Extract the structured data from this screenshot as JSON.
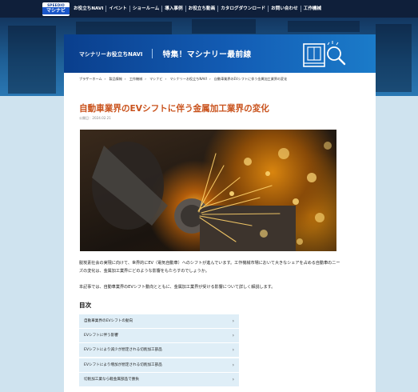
{
  "logo": {
    "line1": "SPEEDIO",
    "line2": "マシナビ"
  },
  "nav": {
    "items": [
      "お役立ちNAVI",
      "イベント",
      "ショールーム",
      "導入事例",
      "お役立ち動画",
      "カタログダウンロード",
      "お問い合わせ",
      "工作機械"
    ]
  },
  "banner": {
    "subtitle": "マシナリーお役立ちNAVI",
    "title": "特集！マシナリー最前線"
  },
  "breadcrumb": [
    "ブラザーホーム",
    "製品情報",
    "工作機械",
    "マシナビ",
    "マシナリーお役立ちNAVI",
    "自動車業界のEVシフトに伴う金属加工業界の変化"
  ],
  "article": {
    "title": "自動車業界のEVシフトに伴う金属加工業界の変化",
    "date": "公開日：2024.02.21",
    "para1": "脱炭素社会の実現に向けて、世界的にEV（電気自動車）へのシフトが進んでいます。工作機械市場において大きなシェアを占める自動車のニーズの変化は、金属加工業界にどのような影響をもたらすのでしょうか。",
    "para2": "本記事では、自動車業界のEVシフト動向とともに、金属加工業界が受ける影響について詳しく解説します。"
  },
  "toc": {
    "heading": "目次",
    "items": [
      "自動車業界のEVシフトの動向",
      "EVシフトに伴う影響",
      "EVシフトにより減少が想定される切削加工部品",
      "EVシフトにより増加が想定される切削加工部品",
      "切削加工業なら軽金属部品で勝負"
    ]
  }
}
